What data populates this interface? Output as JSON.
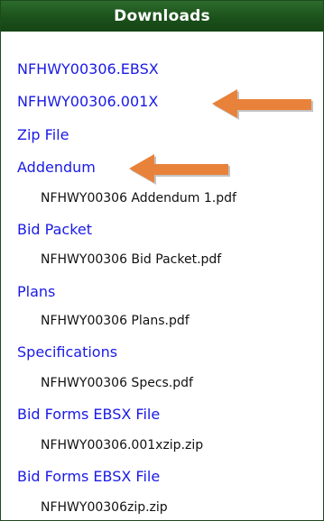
{
  "header": {
    "title": "Downloads"
  },
  "items": [
    {
      "type": "link",
      "label": "NFHWY00306.EBSX"
    },
    {
      "type": "link",
      "label": "NFHWY00306.001X"
    },
    {
      "type": "link",
      "label": "Zip File"
    },
    {
      "type": "link",
      "label": "Addendum"
    },
    {
      "type": "file",
      "label": "NFHWY00306 Addendum 1.pdf"
    },
    {
      "type": "link",
      "label": "Bid Packet"
    },
    {
      "type": "file",
      "label": "NFHWY00306 Bid Packet.pdf"
    },
    {
      "type": "link",
      "label": "Plans"
    },
    {
      "type": "file",
      "label": "NFHWY00306 Plans.pdf"
    },
    {
      "type": "link",
      "label": "Specifications"
    },
    {
      "type": "file",
      "label": "NFHWY00306 Specs.pdf"
    },
    {
      "type": "link",
      "label": "Bid Forms EBSX File"
    },
    {
      "type": "file",
      "label": "NFHWY00306.001xzip.zip"
    },
    {
      "type": "link",
      "label": "Bid Forms EBSX File"
    },
    {
      "type": "file",
      "label": "NFHWY00306zip.zip"
    }
  ],
  "annotations": [
    {
      "icon": "arrow-left-icon",
      "color": "#e8823a",
      "points_to": "NFHWY00306.001X"
    },
    {
      "icon": "arrow-left-icon",
      "color": "#e8823a",
      "points_to": "Addendum"
    }
  ],
  "colors": {
    "header_bg": "#1a4f1a",
    "link": "#1a1ae6",
    "text": "#111111",
    "arrow": "#e8823a"
  }
}
